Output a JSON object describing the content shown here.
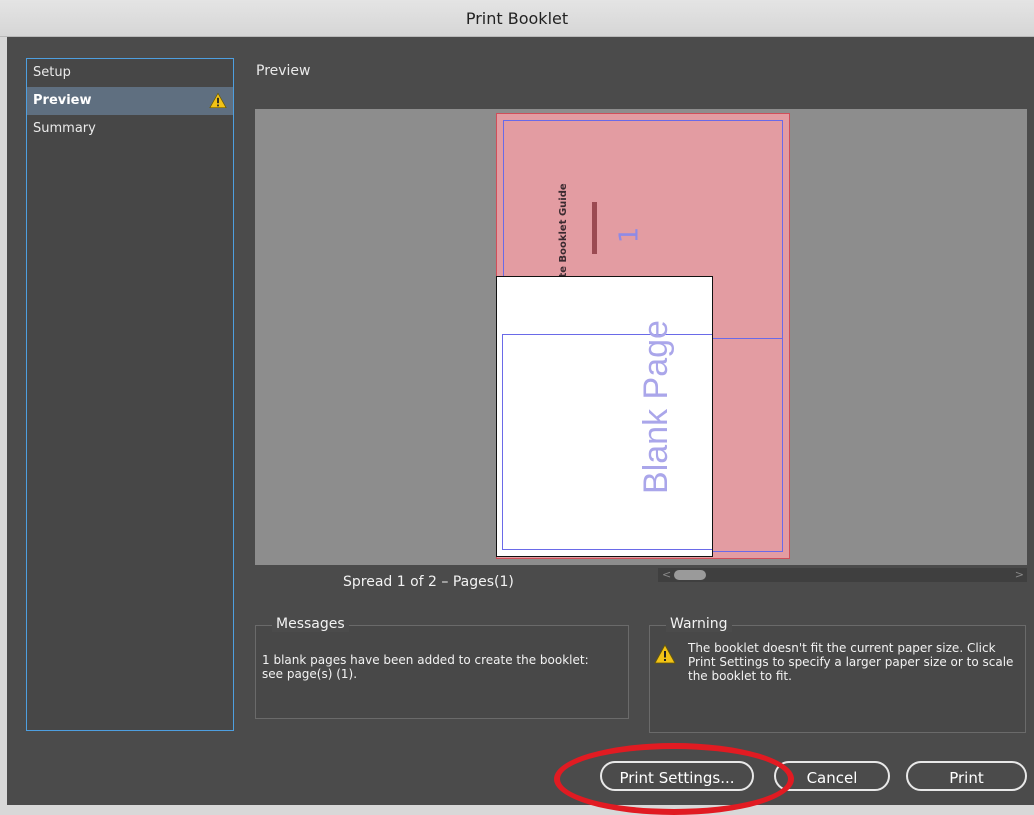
{
  "window": {
    "title": "Print Booklet"
  },
  "sidebar": {
    "items": [
      {
        "label": "Setup",
        "active": false,
        "warning": false
      },
      {
        "label": "Preview",
        "active": true,
        "warning": true
      },
      {
        "label": "Summary",
        "active": false,
        "warning": false
      }
    ]
  },
  "preview": {
    "title": "Preview",
    "book_title": "The Ultimate Booklet Guide",
    "page_number": "1",
    "blank_label": "Blank Page",
    "spread_label": "Spread 1 of 2 – Pages(1)"
  },
  "messages": {
    "title": "Messages",
    "text": "1 blank pages have been added to create the booklet: see page(s) (1)."
  },
  "warning": {
    "title": "Warning",
    "text": "The booklet doesn't fit the current paper size. Click Print Settings to specify a larger paper size or to scale the booklet to fit."
  },
  "buttons": {
    "print_settings": "Print Settings...",
    "cancel": "Cancel",
    "print": "Print"
  },
  "colors": {
    "highlight_annotation": "#e11b22",
    "warning_icon": "#f2c316"
  }
}
